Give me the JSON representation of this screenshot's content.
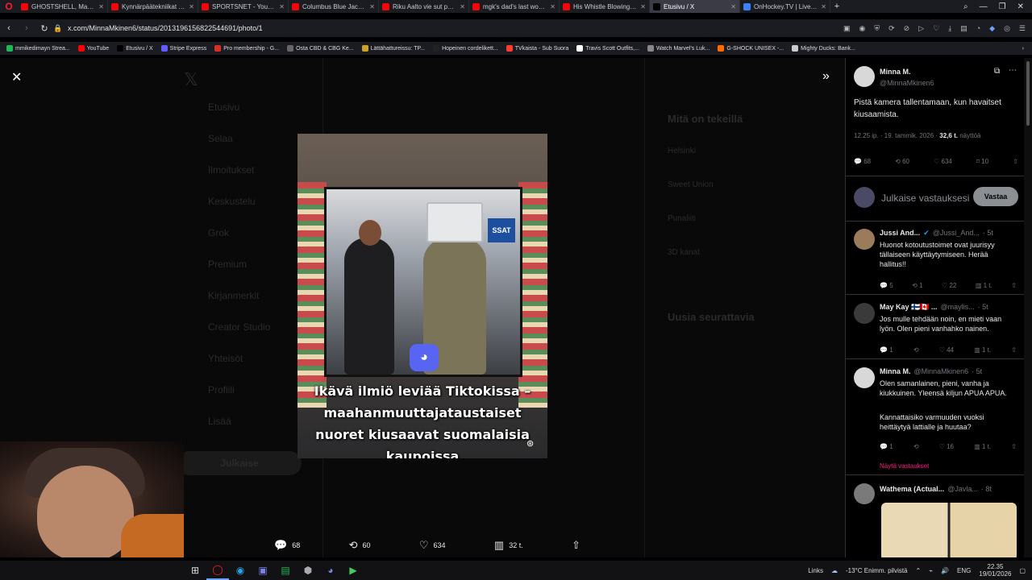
{
  "browser": {
    "tabs": [
      {
        "title": "GHOSTSHELL, Mannequin",
        "color": "#ff0000"
      },
      {
        "title": "Kynnärpäätekniikat itsepu",
        "color": "#ff0000"
      },
      {
        "title": "SPORTSNET - YouTube",
        "color": "#ff0000"
      },
      {
        "title": "Columbus Blue Jackets at",
        "color": "#ff0000"
      },
      {
        "title": "Riku Aalto vie sut paremm",
        "color": "#ff0000"
      },
      {
        "title": "mgk's dad's last words #m",
        "color": "#ff0000"
      },
      {
        "title": "His Whistle Blowing Rap:",
        "color": "#ff0000"
      },
      {
        "title": "Etusivu / X",
        "color": "#000000"
      },
      {
        "title": "OnHockey.TV | Live hocke",
        "color": "#3b82f6"
      }
    ],
    "active_tab_index": 7,
    "url": "x.com/MinnaMkinen6/status/2013196156822544691/photo/1",
    "bookmarks": [
      {
        "label": "mmikedimayn Strea...",
        "color": "#1db954"
      },
      {
        "label": "YouTube",
        "color": "#ff0000"
      },
      {
        "label": "Etusivu / X",
        "color": "#000000"
      },
      {
        "label": "Stripe Express",
        "color": "#635bff"
      },
      {
        "label": "Pro membership - G...",
        "color": "#d93025"
      },
      {
        "label": "Osta CBD & CBG Ke...",
        "color": "#666666"
      },
      {
        "label": "Lättähattureissu: TP...",
        "color": "#c9a227"
      },
      {
        "label": "Hopeinen cordelikett...",
        "color": "#222222"
      },
      {
        "label": "TVkaista - Sub Suora",
        "color": "#ff3b30"
      },
      {
        "label": "Travis Scott Outfits,...",
        "color": "#ffffff"
      },
      {
        "label": "Watch Marvel's Luk...",
        "color": "#888888"
      },
      {
        "label": "G-SHOCK UNISEX -...",
        "color": "#ff6a00"
      },
      {
        "label": "Mighty Ducks: Bank...",
        "color": "#cccccc"
      }
    ]
  },
  "background": {
    "items": [
      "Etusivu",
      "Selaa",
      "Ilmoitukset",
      "Keskustelu",
      "Grok",
      "Premium",
      "Kirjanmerkit",
      "Creator Studio",
      "Yhteisöt",
      "Profiili",
      "Lisää"
    ],
    "post_button": "Julkaise",
    "trends_title": "Mitä on tekeillä",
    "trends": [
      "Helsinki",
      "Sweet Union",
      "Punaliiti",
      "3D kanat"
    ],
    "follow_title": "Uusia seurattavia"
  },
  "photo": {
    "caption": "Ikävä ilmiö leviää Tiktokissa – maahanmuuttajataustaiset nuoret kiusaavat suomalaisia kaupoissa",
    "sign_text": "SSAT"
  },
  "photo_actions": {
    "replies": "68",
    "reposts": "60",
    "likes": "634",
    "views": "32 t."
  },
  "post": {
    "name": "Minna M.",
    "handle": "@MinnaMkinen6",
    "text": "Pistä kamera tallentamaan, kun havaitset kiusaamista.",
    "meta": "12.25 ip. · 19. tammik. 2026 ·",
    "views_count": "32,6 t.",
    "views_label": "näyttöä",
    "stats": {
      "replies": "68",
      "reposts": "60",
      "likes": "634",
      "bookmarks": "10"
    },
    "reply_placeholder": "Julkaise vastauksesi",
    "reply_button": "Vastaa"
  },
  "replies": [
    {
      "name": "Jussi And...",
      "handle": "@Jussi_And...",
      "time": "· 5t",
      "text": "Huonot kotoutustoimet ovat juurisyy tällaiseen käyttäytymiseen. Herää hallitus!!",
      "stats": [
        "5",
        "1",
        "22",
        "1 t."
      ]
    },
    {
      "name": "May Kay 🇫🇮🇨🇦 ...",
      "handle": "@maylis...",
      "time": "· 5t",
      "text": "Jos mulle tehdään noin, en mieti vaan lyön. Olen pieni vanhahko nainen.",
      "stats": [
        "1",
        "",
        "44",
        "1 t."
      ]
    },
    {
      "name": "Minna M.",
      "handle": "@MinnaMkinen6",
      "time": "· 5t",
      "text": "Olen samanlainen, pieni, vanha ja kiukkuinen. Yleensä kiljun APUA APUA.",
      "text2": "Kannattaisiko varmuuden vuoksi heittäytyä lattialle ja huutaa?",
      "stats": [
        "1",
        "",
        "16",
        "1 t."
      ],
      "show_replies": "Näytä vastaukset"
    },
    {
      "name": "Wathema (Actual...",
      "handle": "@Javla...",
      "time": "· 8t",
      "text": ""
    }
  ],
  "taskbar": {
    "links": "Links",
    "weather": "-13°C  Enimm. pilvistä",
    "lang": "ENG",
    "time": "22.35",
    "date": "19/01/2026"
  }
}
